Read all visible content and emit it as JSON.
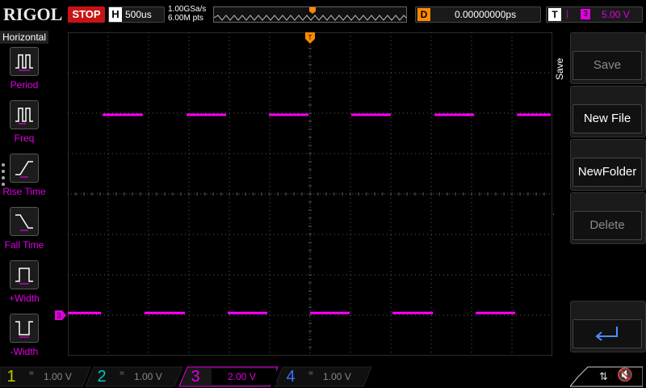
{
  "top": {
    "brand": "RIGOL",
    "run_state": "STOP",
    "timebase_letter": "H",
    "timebase": "500us",
    "sample_rate": "1.00GSa/s",
    "memory_depth": "6.00M pts",
    "delay_letter": "D",
    "delay": "0.00000000ps",
    "trigger_letter": "T",
    "trigger_source": "3",
    "trigger_level": "5.00 V"
  },
  "left_panel": {
    "title": "Horizontal",
    "items": [
      {
        "label": "Period",
        "icon": "period-icon"
      },
      {
        "label": "Freq",
        "icon": "frequency-icon"
      },
      {
        "label": "Rise Time",
        "icon": "rise-time-icon"
      },
      {
        "label": "Fall Time",
        "icon": "fall-time-icon"
      },
      {
        "label": "+Width",
        "icon": "positive-width-icon"
      },
      {
        "label": "-Width",
        "icon": "negative-width-icon"
      }
    ]
  },
  "right_panel": {
    "title": "Save",
    "buttons": [
      {
        "label": "Save",
        "enabled": false
      },
      {
        "label": "New File",
        "enabled": true
      },
      {
        "label": "NewFolder",
        "enabled": true
      },
      {
        "label": "Delete",
        "enabled": false
      }
    ],
    "enter_icon": "enter-return-icon"
  },
  "channels": [
    {
      "num": "1",
      "value": "1.00 V",
      "color": "#c8c800",
      "active": false
    },
    {
      "num": "2",
      "value": "1.00 V",
      "color": "#00c8c8",
      "active": false
    },
    {
      "num": "3",
      "value": "2.00 V",
      "color": "#e000e0",
      "active": true
    },
    {
      "num": "4",
      "value": "1.00 V",
      "color": "#4070ff",
      "active": false
    }
  ],
  "colors": {
    "trace": "#ff00ff",
    "trigger_marker": "#ff8a00",
    "grid": "#5a5a5a"
  },
  "waveform": {
    "channel_marker": "3",
    "trigger_level_marker": "T",
    "trigger_position_marker": "T",
    "high_segments_x": [
      [
        0.072,
        0.158
      ],
      [
        0.245,
        0.33
      ],
      [
        0.415,
        0.5
      ],
      [
        0.585,
        0.67
      ],
      [
        0.757,
        0.842
      ],
      [
        0.927,
        1.0
      ]
    ],
    "low_segments_x": [
      [
        0.0,
        0.072
      ],
      [
        0.158,
        0.245
      ],
      [
        0.33,
        0.415
      ],
      [
        0.5,
        0.585
      ],
      [
        0.67,
        0.757
      ],
      [
        0.842,
        0.927
      ]
    ],
    "high_level": 0.255,
    "low_level": 0.868
  }
}
